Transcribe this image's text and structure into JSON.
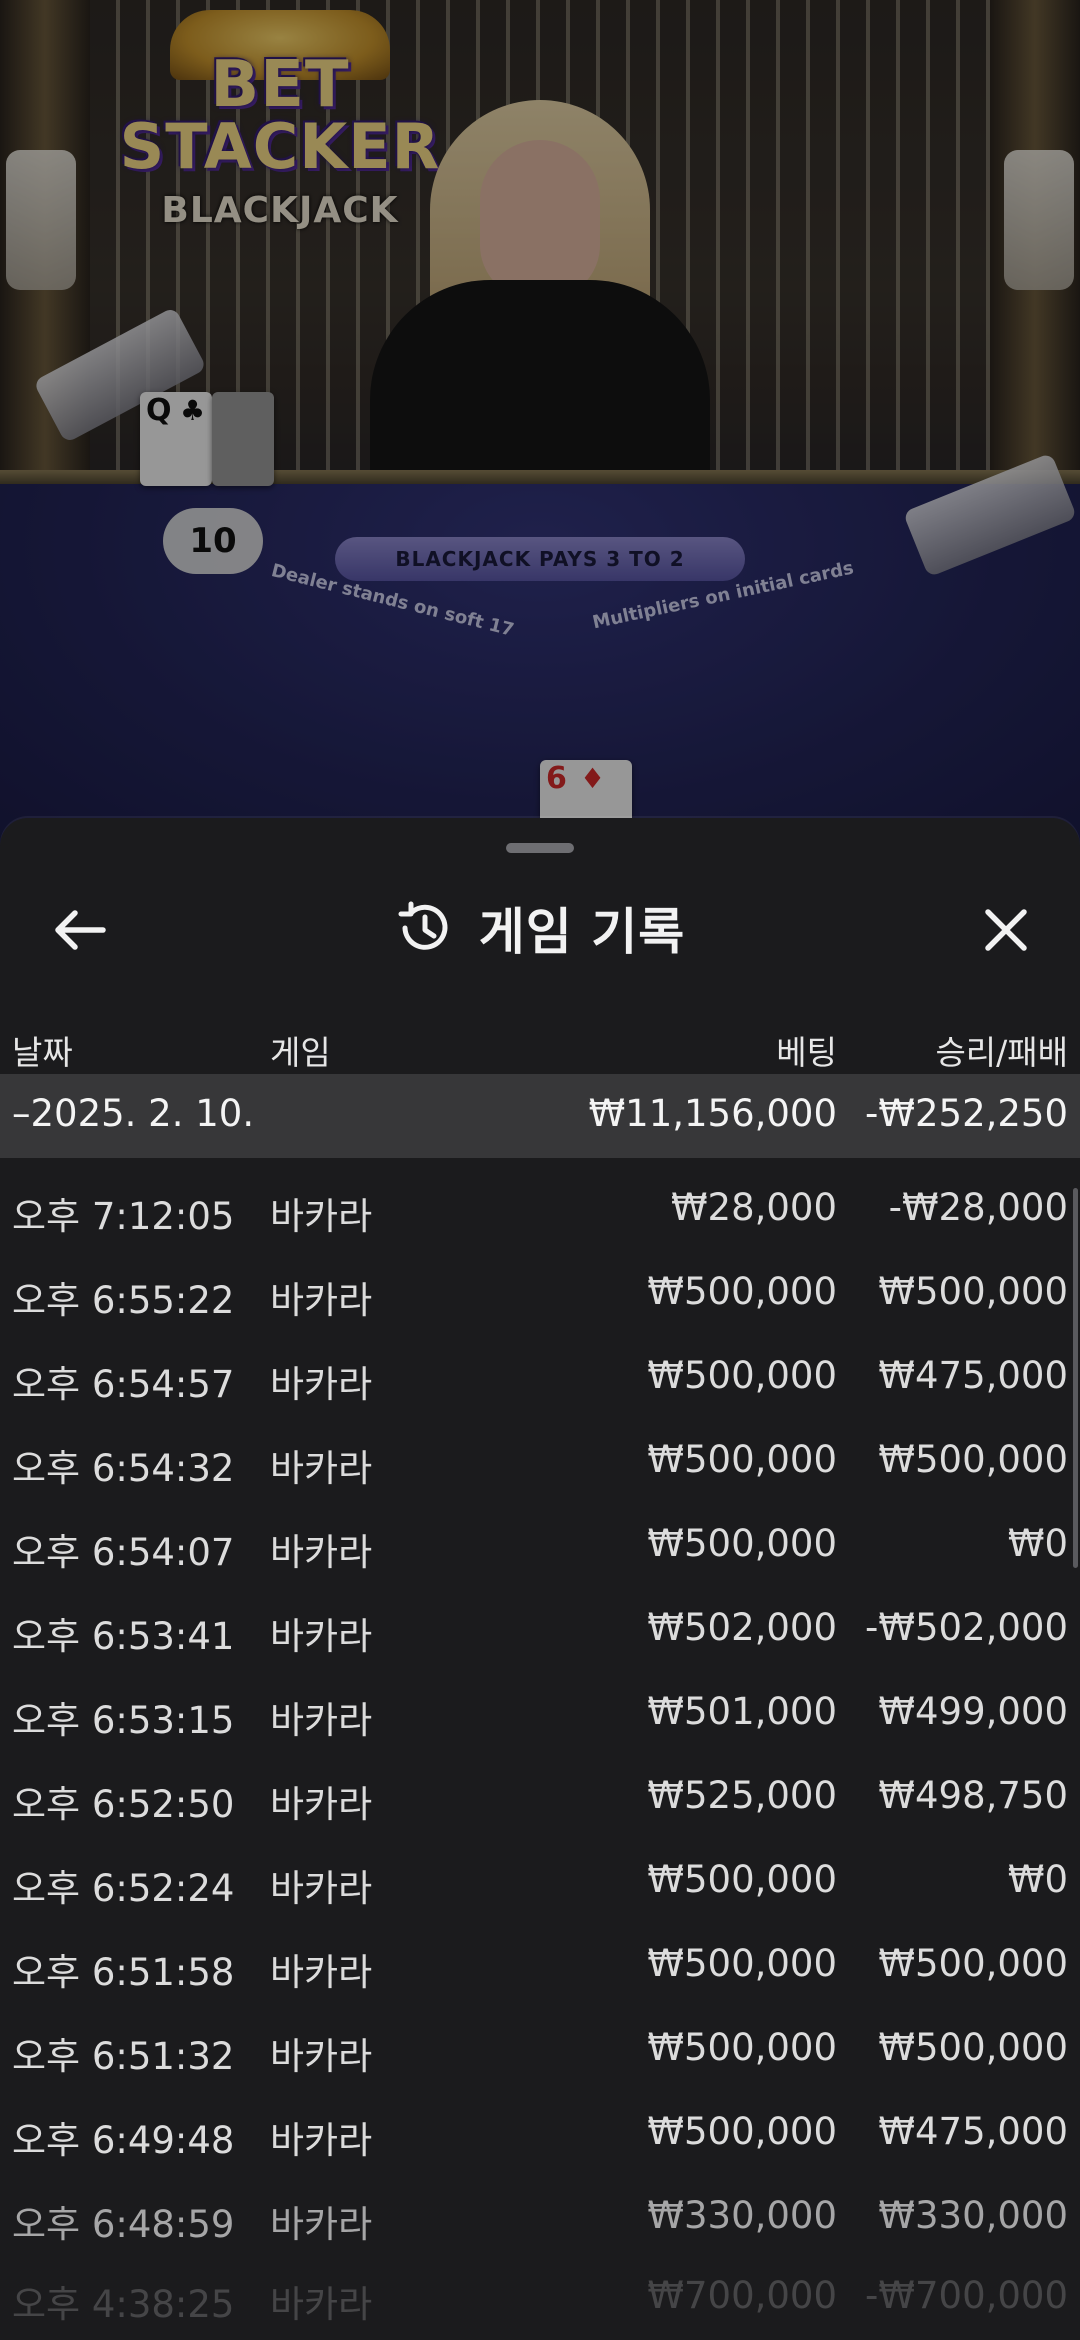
{
  "video": {
    "logo": {
      "line1": "BET",
      "line2": "STACKER",
      "line3": "BLACKJACK"
    },
    "table": {
      "banner": "BLACKJACK PAYS 3 TO 2",
      "left_text": "Dealer stands on soft 17",
      "right_text": "Multipliers on initial cards"
    },
    "dealer_card": {
      "rank": "Q",
      "suit": "♣"
    },
    "dealer_score": "10",
    "player_card": {
      "rank": "6",
      "suit": "♦"
    }
  },
  "header": {
    "title": "게임 기록",
    "back_icon": "arrow-left-icon",
    "history_icon": "history-clock-icon",
    "close_icon": "close-icon"
  },
  "columns": {
    "date": "날짜",
    "game": "게임",
    "bet": "베팅",
    "win_loss": "승리/패배"
  },
  "summary": {
    "date": "–2025. 2. 10.",
    "bet": "₩11,156,000",
    "win_loss": "-₩252,250"
  },
  "rows": [
    {
      "time": "오후 7:12:05",
      "game": "바카라",
      "bet": "₩28,000",
      "win_loss": "-₩28,000"
    },
    {
      "time": "오후 6:55:22",
      "game": "바카라",
      "bet": "₩500,000",
      "win_loss": "₩500,000"
    },
    {
      "time": "오후 6:54:57",
      "game": "바카라",
      "bet": "₩500,000",
      "win_loss": "₩475,000"
    },
    {
      "time": "오후 6:54:32",
      "game": "바카라",
      "bet": "₩500,000",
      "win_loss": "₩500,000"
    },
    {
      "time": "오후 6:54:07",
      "game": "바카라",
      "bet": "₩500,000",
      "win_loss": "₩0"
    },
    {
      "time": "오후 6:53:41",
      "game": "바카라",
      "bet": "₩502,000",
      "win_loss": "-₩502,000"
    },
    {
      "time": "오후 6:53:15",
      "game": "바카라",
      "bet": "₩501,000",
      "win_loss": "₩499,000"
    },
    {
      "time": "오후 6:52:50",
      "game": "바카라",
      "bet": "₩525,000",
      "win_loss": "₩498,750"
    },
    {
      "time": "오후 6:52:24",
      "game": "바카라",
      "bet": "₩500,000",
      "win_loss": "₩0"
    },
    {
      "time": "오후 6:51:58",
      "game": "바카라",
      "bet": "₩500,000",
      "win_loss": "₩500,000"
    },
    {
      "time": "오후 6:51:32",
      "game": "바카라",
      "bet": "₩500,000",
      "win_loss": "₩500,000"
    },
    {
      "time": "오후 6:49:48",
      "game": "바카라",
      "bet": "₩500,000",
      "win_loss": "₩475,000"
    },
    {
      "time": "오후 6:48:59",
      "game": "바카라",
      "bet": "₩330,000",
      "win_loss": "₩330,000"
    },
    {
      "time": "오후 4:38:25",
      "game": "바카라",
      "bet": "₩700,000",
      "win_loss": "-₩700,000"
    }
  ]
}
